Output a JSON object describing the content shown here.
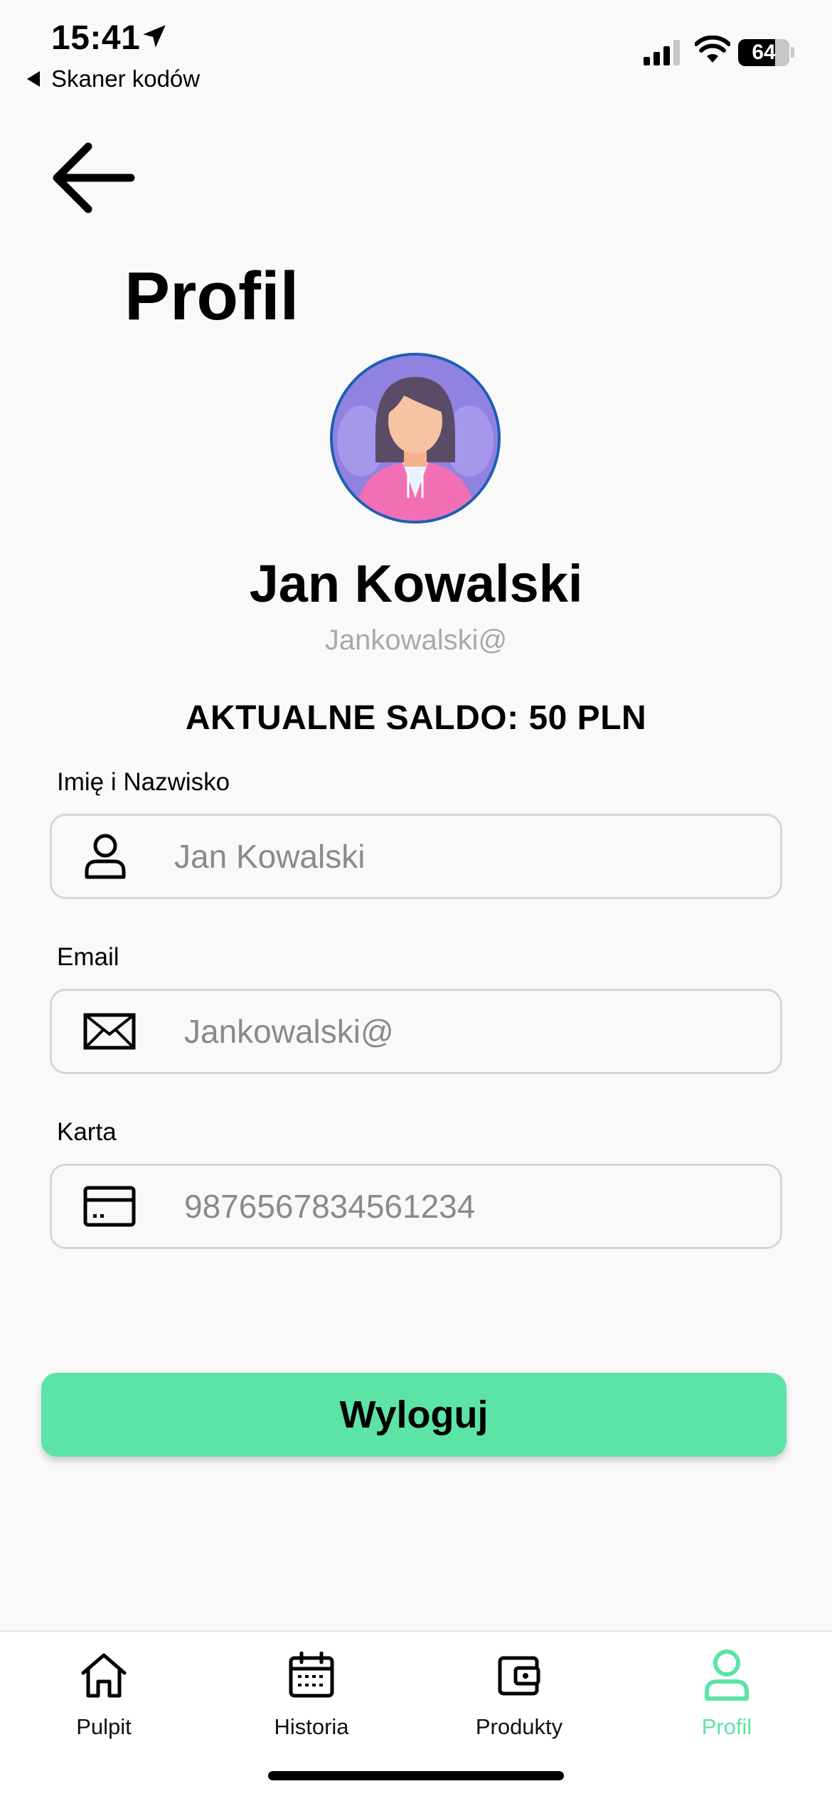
{
  "status_bar": {
    "time": "15:41",
    "back_app": "Skaner kodów",
    "battery": "64",
    "icons": [
      "location-arrow-icon",
      "signal-icon",
      "wifi-icon",
      "battery-icon"
    ]
  },
  "header": {
    "back_icon": "arrow-left-icon",
    "title": "Profil"
  },
  "profile": {
    "avatar_icon": "avatar-woman-icon",
    "name": "Jan Kowalski",
    "email": "Jankowalski@",
    "balance": "AKTUALNE SALDO: 50 PLN"
  },
  "form": {
    "name_label": "Imię i Nazwisko",
    "name_value": "Jan Kowalski",
    "name_icon": "user-icon",
    "email_label": "Email",
    "email_value": "Jankowalski@",
    "email_icon": "envelope-icon",
    "card_label": "Karta",
    "card_value": "9876567834561234",
    "card_icon": "credit-card-icon"
  },
  "logout_label": "Wyloguj",
  "tabbar": {
    "items": [
      {
        "label": "Pulpit",
        "icon": "home-icon",
        "active": false
      },
      {
        "label": "Historia",
        "icon": "calendar-icon",
        "active": false
      },
      {
        "label": "Produkty",
        "icon": "wallet-icon",
        "active": false
      },
      {
        "label": "Profil",
        "icon": "user-icon",
        "active": true
      }
    ]
  },
  "colors": {
    "accent": "#5ce4a6",
    "background": "#f9f9fa",
    "field_border": "#d6d6d6",
    "muted_text": "#a9a9a9"
  }
}
